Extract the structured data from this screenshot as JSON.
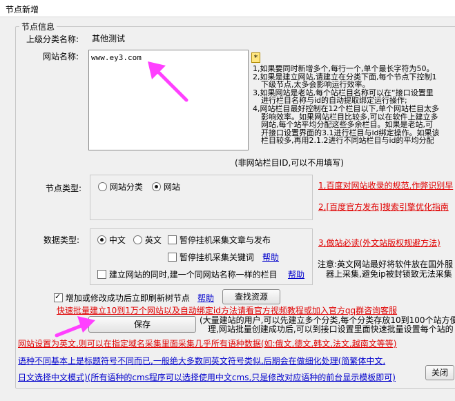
{
  "window": {
    "title": "节点新增"
  },
  "group": {
    "title": "节点信息"
  },
  "parent": {
    "label": "上级分类名称:",
    "value": "其他测试"
  },
  "site": {
    "label": "网站名称:",
    "value": "www.ey3.com",
    "hint_marker": "*",
    "hints": [
      "1,如果要同时新增多个,每行一个,单个最长字符为50。",
      "2,如果是建立网站,请建立在分类下面,每个节点下控制1",
      "下级节点,太多会影响运行效率。",
      "3,如果网站是老站,每个站栏目名称可以在“接口设置里",
      "进行栏目名称与id的自动提取绑定运行操作;",
      "4,网站栏目最好控制在12个栏目以下,单个网站栏目太多",
      "影响效率。如果网站栏目比较多,可以在软件上建立多",
      "网站,每个站平均分配这些多余栏目。如果是老站,可",
      "开接口设置界面的3.1进行栏目与id绑定操作。如果该",
      "栏目较多,再用2.1.2进行不同站栏目与id的平均分配"
    ],
    "note": "(非网站栏目ID,可以不用填写)"
  },
  "node_type": {
    "label": "节点类型:",
    "options": [
      "网站分类",
      "网站"
    ],
    "selected": "网站",
    "links": [
      "1,百度对网站收录的规范,作弊识别早",
      "2,[百度官方发布]搜索引擎优化指南"
    ]
  },
  "data_type": {
    "label": "数据类型:",
    "lang_options": [
      "中文",
      "英文"
    ],
    "selected": "中文",
    "pause_publish": "暂停挂机采集文章与发布",
    "pause_keywords": "暂停挂机采集关键词",
    "help": "帮助",
    "same_column": "建立网站的同时,建一个同网站名称一样的栏目",
    "link3": "3,做站必读(外文站版权规避方法)",
    "note_lines": [
      "注意:英文网站最好将软件放在国外服",
      "器上采集,避免ip被封锁致无法采集"
    ]
  },
  "refresh": {
    "label": "增加或修改成功后立即刷新树节点",
    "checked": true,
    "help": "帮助",
    "find_button": "查找资源"
  },
  "promo_link": "快速批量建立10到1万个网站以及自动绑定id方法请看官方视频教程或加入官方qq群咨询客服",
  "save_button": "保存",
  "save_note": [
    "(大量建站的用户,可以先建立多个分类,每个分类存放10到100个站方便",
    "理,网站批量创建成功后,可以到接口设置里面快速批量设置每个站的"
  ],
  "eng_note": "网站设置为英文,则可以在指定域名采集里面采集几乎所有语种数据(如:俄文,德文,韩文,法文,越南文等等)",
  "lang_note1": "语种不同基本上是标题符号不同而已,一般绝大多数同英文符号类似,后期会在做细化处理(简繁体中文,",
  "lang_note2": "日文选择中文模式)(所有语种的cms程序可以选择使用中文cms,只是修改对应语种的前台显示模板即可)",
  "close_button": "关闭",
  "colors": {
    "accent_red": "#e00000",
    "link_blue": "#0000cc",
    "arrow": "#ff40ff"
  }
}
